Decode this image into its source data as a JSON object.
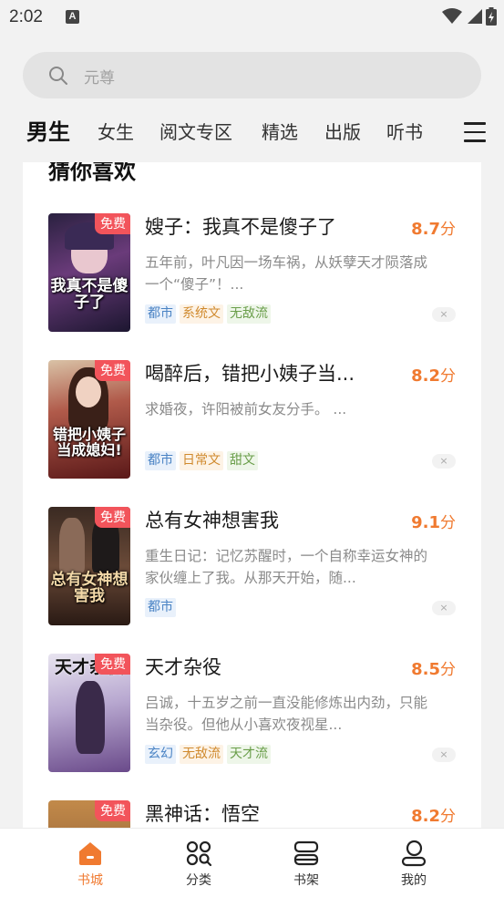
{
  "status": {
    "time": "2:02",
    "notif_letter": "A"
  },
  "search": {
    "placeholder": "元尊"
  },
  "tabs": [
    {
      "label": "男生",
      "active": true
    },
    {
      "label": "女生"
    },
    {
      "label": "阅文专区"
    },
    {
      "label": "精选"
    },
    {
      "label": "出版"
    },
    {
      "label": "听书"
    }
  ],
  "section": {
    "title": "猜你喜欢"
  },
  "books": [
    {
      "title": "嫂子：我真不是傻子了",
      "score": "8.7",
      "score_unit": "分",
      "badge": "免费",
      "desc": "五年前，叶凡因一场车祸，从妖孽天才陨落成一个“傻子”！...",
      "tags": [
        "都市",
        "系统文",
        "无敌流"
      ],
      "cover_text": "我真不是傻子了",
      "dismiss": "×"
    },
    {
      "title": "喝醉后，错把小姨子当...",
      "score": "8.2",
      "score_unit": "分",
      "badge": "免费",
      "desc": "求婚夜，许阳被前女友分手。 ...",
      "tags": [
        "都市",
        "日常文",
        "甜文"
      ],
      "cover_text": "错把小姨子当成媳妇!",
      "dismiss": "×"
    },
    {
      "title": "总有女神想害我",
      "score": "9.1",
      "score_unit": "分",
      "badge": "免费",
      "desc": "重生日记：记忆苏醒时，一个自称幸运女神的家伙缠上了我。从那天开始，随...",
      "tags": [
        "都市"
      ],
      "cover_text": "总有女神想害我",
      "dismiss": "×"
    },
    {
      "title": "天才杂役",
      "score": "8.5",
      "score_unit": "分",
      "badge": "免费",
      "desc": "吕诚，十五岁之前一直没能修炼出内劲，只能当杂役。但他从小喜欢夜视星...",
      "tags": [
        "玄幻",
        "无敌流",
        "天才流"
      ],
      "cover_text": "天才杂役",
      "dismiss": "×"
    },
    {
      "title": "黑神话：悟空",
      "score": "8.2",
      "score_unit": "分",
      "badge": "免费",
      "desc": "",
      "tags": [],
      "cover_text": "",
      "dismiss": ""
    }
  ],
  "bottom_nav": [
    {
      "label": "书城",
      "icon": "home-icon",
      "active": true
    },
    {
      "label": "分类",
      "icon": "category-icon"
    },
    {
      "label": "书架",
      "icon": "bookshelf-icon"
    },
    {
      "label": "我的",
      "icon": "profile-icon"
    }
  ],
  "colors": {
    "accent": "#f07a30",
    "free_badge": "#f2545b"
  }
}
